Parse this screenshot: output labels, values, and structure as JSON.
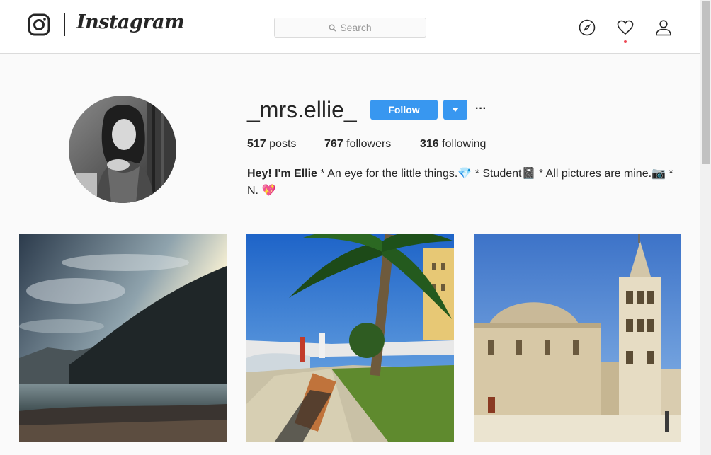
{
  "header": {
    "brand": "Instagram",
    "search_placeholder": "Search"
  },
  "nav": {
    "icons": [
      "explore-compass-icon",
      "activity-heart-icon",
      "profile-person-icon"
    ],
    "notification_color": "#ed4956"
  },
  "profile": {
    "username": "_mrs.ellie_",
    "follow_label": "Follow",
    "more_label": "···",
    "stats": {
      "posts_count": "517",
      "posts_label": "posts",
      "followers_count": "767",
      "followers_label": "followers",
      "following_count": "316",
      "following_label": "following"
    },
    "bio_name": "Hey! I'm Ellie",
    "bio_text": " * An eye for the little things.💎 * Student📓 * All pictures are mine.📷 * N. 💖"
  },
  "colors": {
    "accent": "#3897f0",
    "border": "#dbdbdb",
    "background": "#fafafa"
  },
  "posts": [
    "mountain-lake-sunset-photo",
    "palm-promenade-photo",
    "church-bell-tower-photo"
  ]
}
